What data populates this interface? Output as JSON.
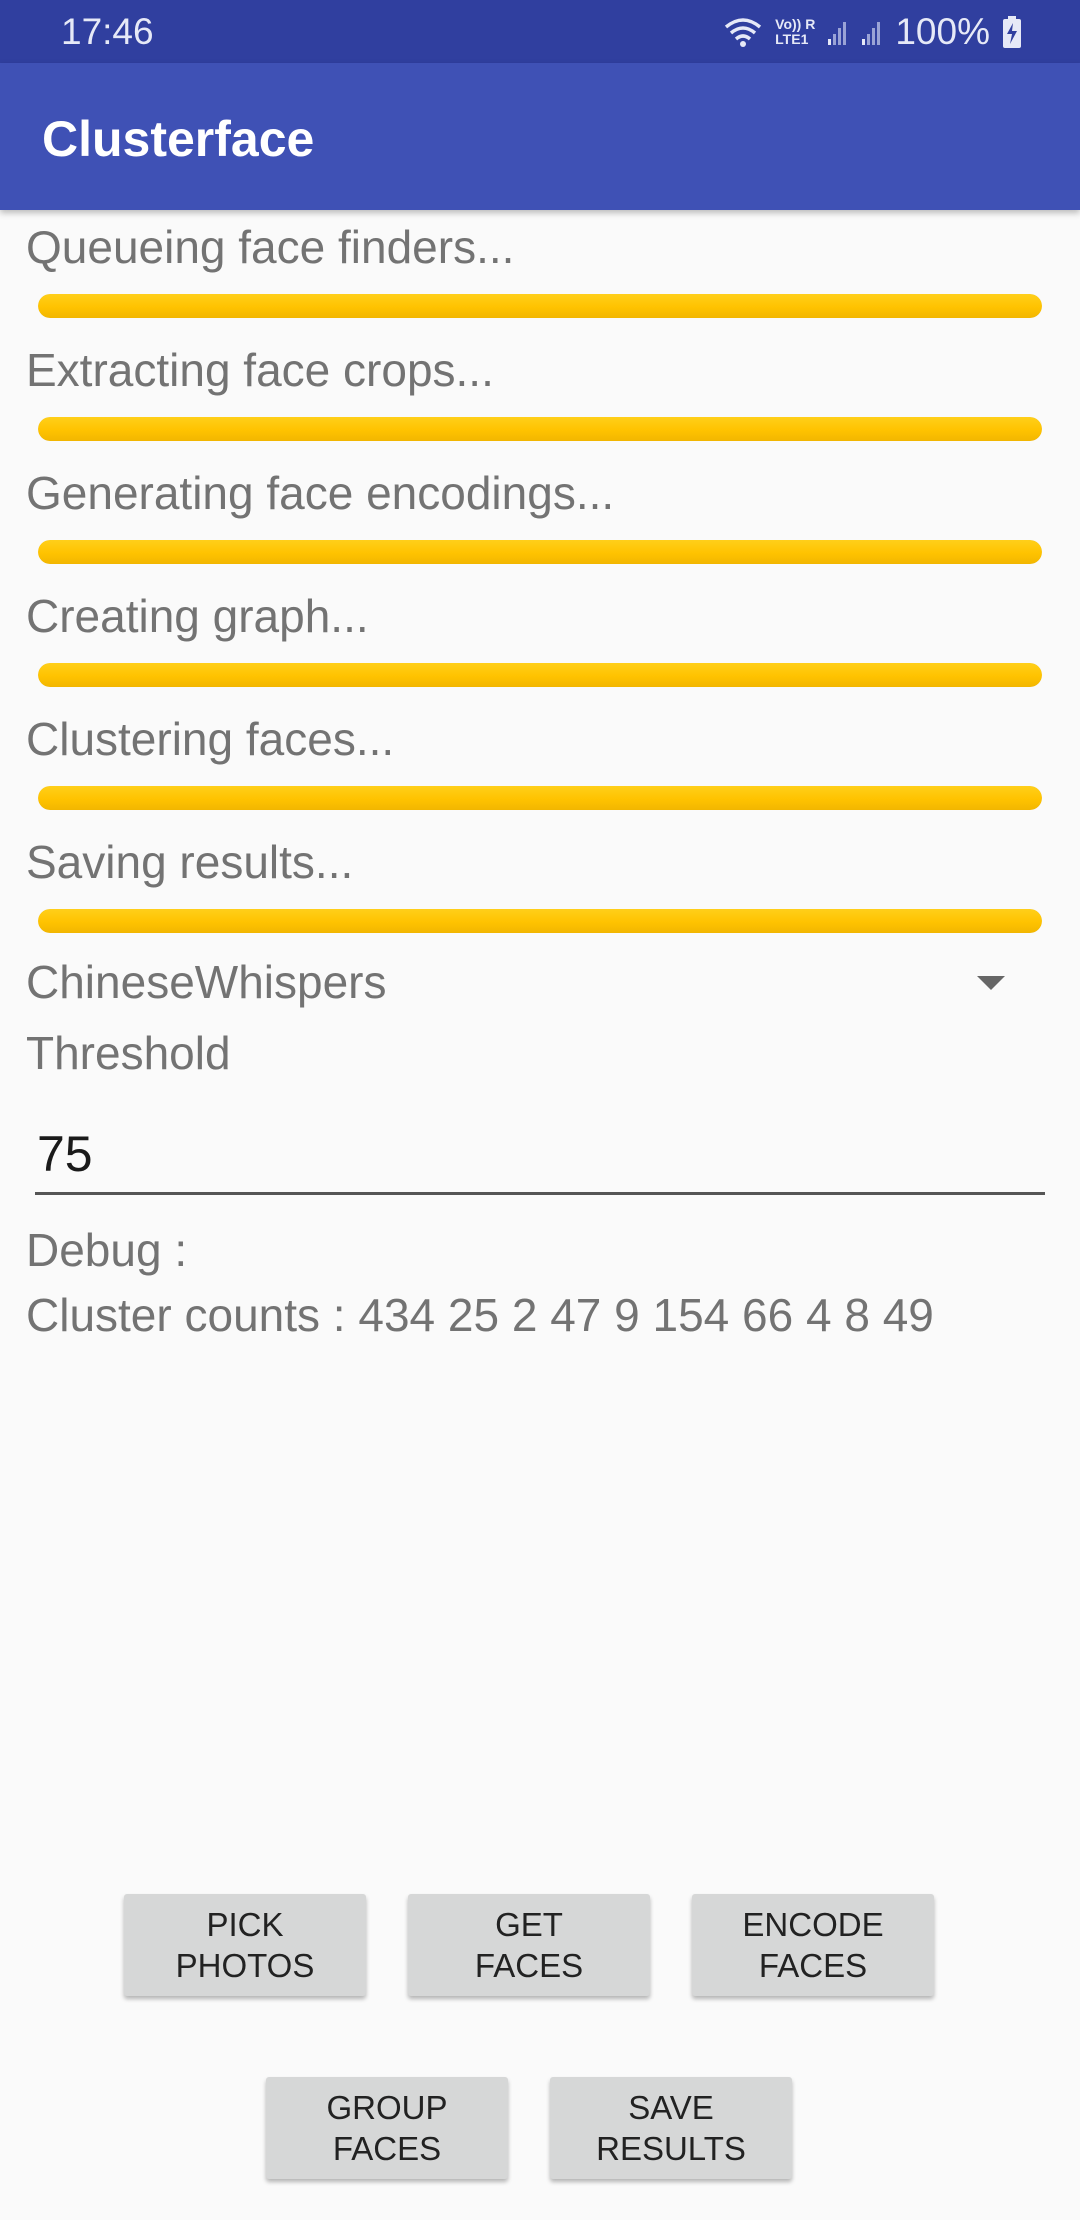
{
  "status_bar": {
    "time": "17:46",
    "network_label_top": "Vo)) R",
    "network_label_bottom": "LTE1",
    "battery": "100%",
    "icons": [
      "wifi-icon",
      "lte-signal-icon",
      "signal-icon",
      "signal-icon",
      "battery-charging-icon"
    ]
  },
  "app_bar": {
    "title": "Clusterface"
  },
  "steps": [
    {
      "label": "Queueing face finders...",
      "progress": 1.0
    },
    {
      "label": "Extracting face crops...",
      "progress": 1.0
    },
    {
      "label": "Generating face encodings...",
      "progress": 1.0
    },
    {
      "label": "Creating graph...",
      "progress": 1.0
    },
    {
      "label": "Clustering faces...",
      "progress": 1.0
    },
    {
      "label": "Saving results...",
      "progress": 1.0
    }
  ],
  "progress_color": "#ffc107",
  "algorithm_spinner": {
    "selected": "ChineseWhispers",
    "icon": "dropdown-arrow-icon"
  },
  "threshold": {
    "label": "Threshold",
    "value": "75"
  },
  "debug": {
    "label": "Debug :",
    "cluster_counts": "Cluster counts : 434 25 2 47 9 154 66 4 8 49"
  },
  "buttons": {
    "pick_photos": "PICK\nPHOTOS",
    "get_faces": "GET\nFACES",
    "encode_faces": "ENCODE\nFACES",
    "group_faces": "GROUP\nFACES",
    "save_results": "SAVE\nRESULTS"
  },
  "colors": {
    "status_bar": "#303f9f",
    "app_bar": "#3f51b5",
    "button": "#d6d7d7",
    "background": "#fafafa"
  }
}
